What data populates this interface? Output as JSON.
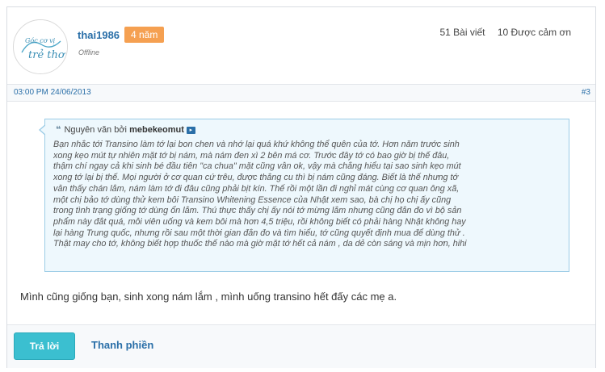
{
  "user": {
    "avatar_text_1": "Góc cơ vị",
    "avatar_text_2": "trẻ thơ",
    "username": "thai1986",
    "badge": "4 năm",
    "status": "Offline",
    "posts": "51 Bài viết",
    "thanks": "10 Được cảm ơn"
  },
  "meta": {
    "datetime": "03:00 PM 24/06/2013",
    "post_number": "#3"
  },
  "quote": {
    "prefix": "Nguyên văn bởi",
    "author": "mebekeomut",
    "lines": [
      "Bạn nhắc tới Transino làm tớ lại bon chen và nhớ lại quá khứ không thể quên của tớ. Hơn năm trước sinh",
      "xong kẹo mút tự nhiên mặt tớ bị nám, mà nám đen xì 2 bên má cơ. Trước đây tớ có bao giờ bị thế đâu,",
      "thậm chí ngay cả khi sinh bé đầu tiên \"ca chua\" mặt cũng vẫn ok, vậy mà chẳng hiểu tại sao sinh kẹo mút",
      "xong tớ lại bị thế. Mọi người ở cơ quan cứ trêu, được thằng cu thì bị nám cũng đáng. Biết là thế nhưng tớ",
      "vẫn thấy chán lắm, nám làm tớ đi đâu cũng phải bịt kín. Thế rồi một lần đi nghỉ mát cùng cơ quan ông xã,",
      "một chị bảo tớ dùng thử kem bôi Transino Whitening Essence của Nhật xem sao, bà chị họ chị ấy cũng",
      "trong tình trạng giống tớ dùng ổn lắm. Thú thực thấy chị ấy nói tớ mừng lắm nhưng cũng đắn đo vì bộ sản",
      "phẩm này đắt quá, mỗi viên uống và kem bôi mà hơn 4,5 triệu, rồi không biết có phải hàng Nhật không hay",
      "lại hàng Trung quốc, nhưng rồi sau một thời gian đắn đo và tìm hiểu, tớ cũng quyết định mua để dùng thử .",
      "Thật may cho tớ, không biết hợp thuốc thế nào mà giờ mặt tớ hết cả nám , da dẻ còn sáng và mịn hơn, hihi"
    ]
  },
  "message": "Mình cũng giống bạn, sinh xong nám lắm , mình uống transino hết đấy các mẹ a.",
  "actions": {
    "reply": "Trả lời",
    "thanks": "Thanh phiền"
  }
}
